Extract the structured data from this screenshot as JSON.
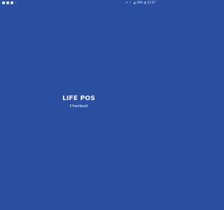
{
  "status_bar": {
    "left_icons": [
      "notification-icon-1",
      "notification-icon-2",
      "notification-icon-3"
    ],
    "right_icons": [
      "mute-icon",
      "wifi-icon",
      "signal-icon"
    ],
    "battery": "29%",
    "time": "15:47"
  },
  "splash": {
    "title": "LIFE POS",
    "subtitle": "Checkout"
  },
  "colors": {
    "background": "#2a4ea0",
    "text": "#ffffff"
  }
}
